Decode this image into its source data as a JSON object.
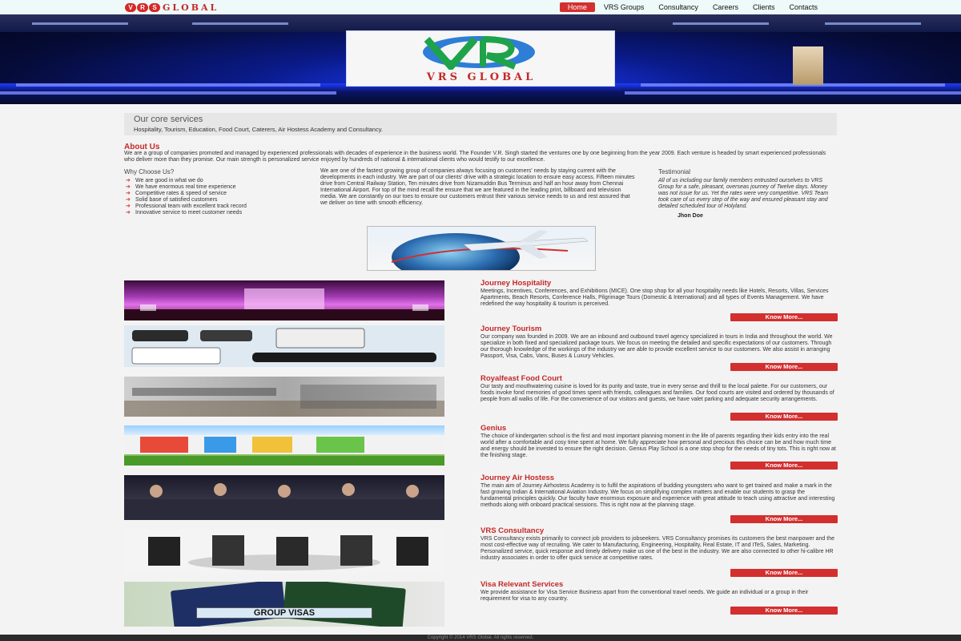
{
  "header": {
    "logo_letters": [
      "V",
      "R",
      "S"
    ],
    "logo_word": "GLOBAL",
    "nav": [
      {
        "label": "Home",
        "active": true
      },
      {
        "label": "VRS Groups"
      },
      {
        "label": "Consultancy"
      },
      {
        "label": "Careers"
      },
      {
        "label": "Clients"
      },
      {
        "label": "Contacts"
      }
    ]
  },
  "hero": {
    "brand": "VRS GLOBAL"
  },
  "core": {
    "title": "Our core services",
    "text": "Hospitality, Tourism, Education, Food Court, Caterers, Air Hostess Academy and Consultancy."
  },
  "about": {
    "title": "About Us",
    "text": "We are a group of companies promoted and managed by experienced professionals with decades of experience in the business world. The Founder V.R. Singh started the ventures one by one beginning from the year 2009. Each venture is headed by smart experienced professionals who deliver more than they promise. Our main strength is personalized service enjoyed by hundreds of national & international clients who would testify to our excellence.",
    "why_title": "Why Choose Us?",
    "why_items": [
      "We are good in what we do",
      "We have enormous real time experience",
      "Competitive rates & speed of service",
      "Solid base of satisfied customers",
      "Professional team with excellent track record",
      "Innovative service to meet customer needs"
    ],
    "mid_text": "We are one of the fastest growing group of companies always focusing on customers' needs by staying current with the developments in each industry. We are part of our clients' drive with a strategic location to ensure easy access. Fifteen minutes drive from Central Railway Station, Ten minutes drive from Nizamuddin Bus Terminus and half an hour away from Chennai International Airport. For top of the mind recall the ensure that we are featured in the leading print, billboard and television media. We are constantly on our toes to ensure our customers entrust their various service needs to us and rest assured that we deliver on time with smooth efficiency.",
    "testimonial_title": "Testimonial",
    "testimonial_text": "All of us including our family members entrusted ourselves to VRS Group for a safe, pleasant, overseas journey of Twelve days. Money was not issue for us. Yet the rates were very competitive. VRS Team took care of us every step of the way and ensured pleasant stay and detailed scheduled tour of Holyland.",
    "testimonial_author": "Jhon Doe"
  },
  "sections": [
    {
      "title": "Journey Hospitality",
      "text": "Meetings, Incentives, Conferences, and Exhibitions (MICE). One stop shop for all your hospitality needs like Hotels, Resorts, Villas, Services Apartments, Beach Resorts, Conference Halls, Pilgrimage Tours (Domestic & International) and all types of Events Management. We have redefined the way hospitality & tourism is perceived.",
      "button": "Know More..."
    },
    {
      "title": "Journey Tourism",
      "text": "Our company was founded in 2009. We are an inbound and outbound travel agency specialized in tours in India and throughout the world. We specialize in both fixed and specialized package tours. We focus on meeting the detailed and specific expectations of our customers. Through our thorough knowledge of the workings of the industry we are able to provide excellent service to our customers. We also assist in arranging Passport, Visa, Cabs, Vans, Buses & Luxury Vehicles.",
      "button": "Know More..."
    },
    {
      "title": "Royalfeast Food Court",
      "text": "Our tasty and mouthwatering cuisine is loved for its purity and taste, true in every sense and thrill to the local palette. For our customers, our foods invoke fond memories of good times spent with friends, colleagues and families. Our food courts are visited and ordered by thousands of people from all walks of life. For the convenience of our visitors and guests, we have valet parking and adequate security arrangements.",
      "button": "Know More..."
    },
    {
      "title": "Genius",
      "text": "The choice of kindergarten school is the first and most important planning moment in the life of parents regarding their kids entry into the real world after a comfortable and cosy time spent at home. We fully appreciate how personal and precious this choice can be and how much time and energy should be invested to ensure the right decision. Genius Play School is a one stop shop for the needs of tiny tots. This is right now at the finishing stage.",
      "button": "Know More..."
    },
    {
      "title": "Journey Air Hostess",
      "text": "The main aim of Journey Airhostess Academy is to fulfil the aspirations of budding youngsters who want to get trained and make a mark in the fast growing Indian & International Aviation Industry. We focus on simplifying complex matters and enable our students to grasp the fundamental principles quickly. Our faculty have enormous exposure and experience with great attitude to teach using attractive and interesting methods along with onboard practical sessions. This is right now at the planning stage.",
      "button": "Know More..."
    },
    {
      "title": "VRS Consultancy",
      "text": "VRS Consultancy exists primarily to connect job providers to jobseekers. VRS Consultancy promises its customers the best manpower and the most cost-effective way of recruiting. We cater to Manufacturing, Engineering, Hospitality, Real Estate, IT and ITeS, Sales, Marketing. Personalized service, quick response and timely delivery make us one of the best in the industry. We are also connected to other hi-calibre HR industry associates in order to offer quick service at competitive rates.",
      "button": "Know More..."
    },
    {
      "title": "Visa Relevant Services",
      "text": "We provide assistance for Visa Service Business apart from the conventional travel needs. We guide an individual or a group in their requirement for visa to any country.",
      "button": "Know More..."
    }
  ],
  "visa_banner": "GROUP VISAS",
  "footer": "Copyright © 2014 VRS Global. All rights reserved."
}
